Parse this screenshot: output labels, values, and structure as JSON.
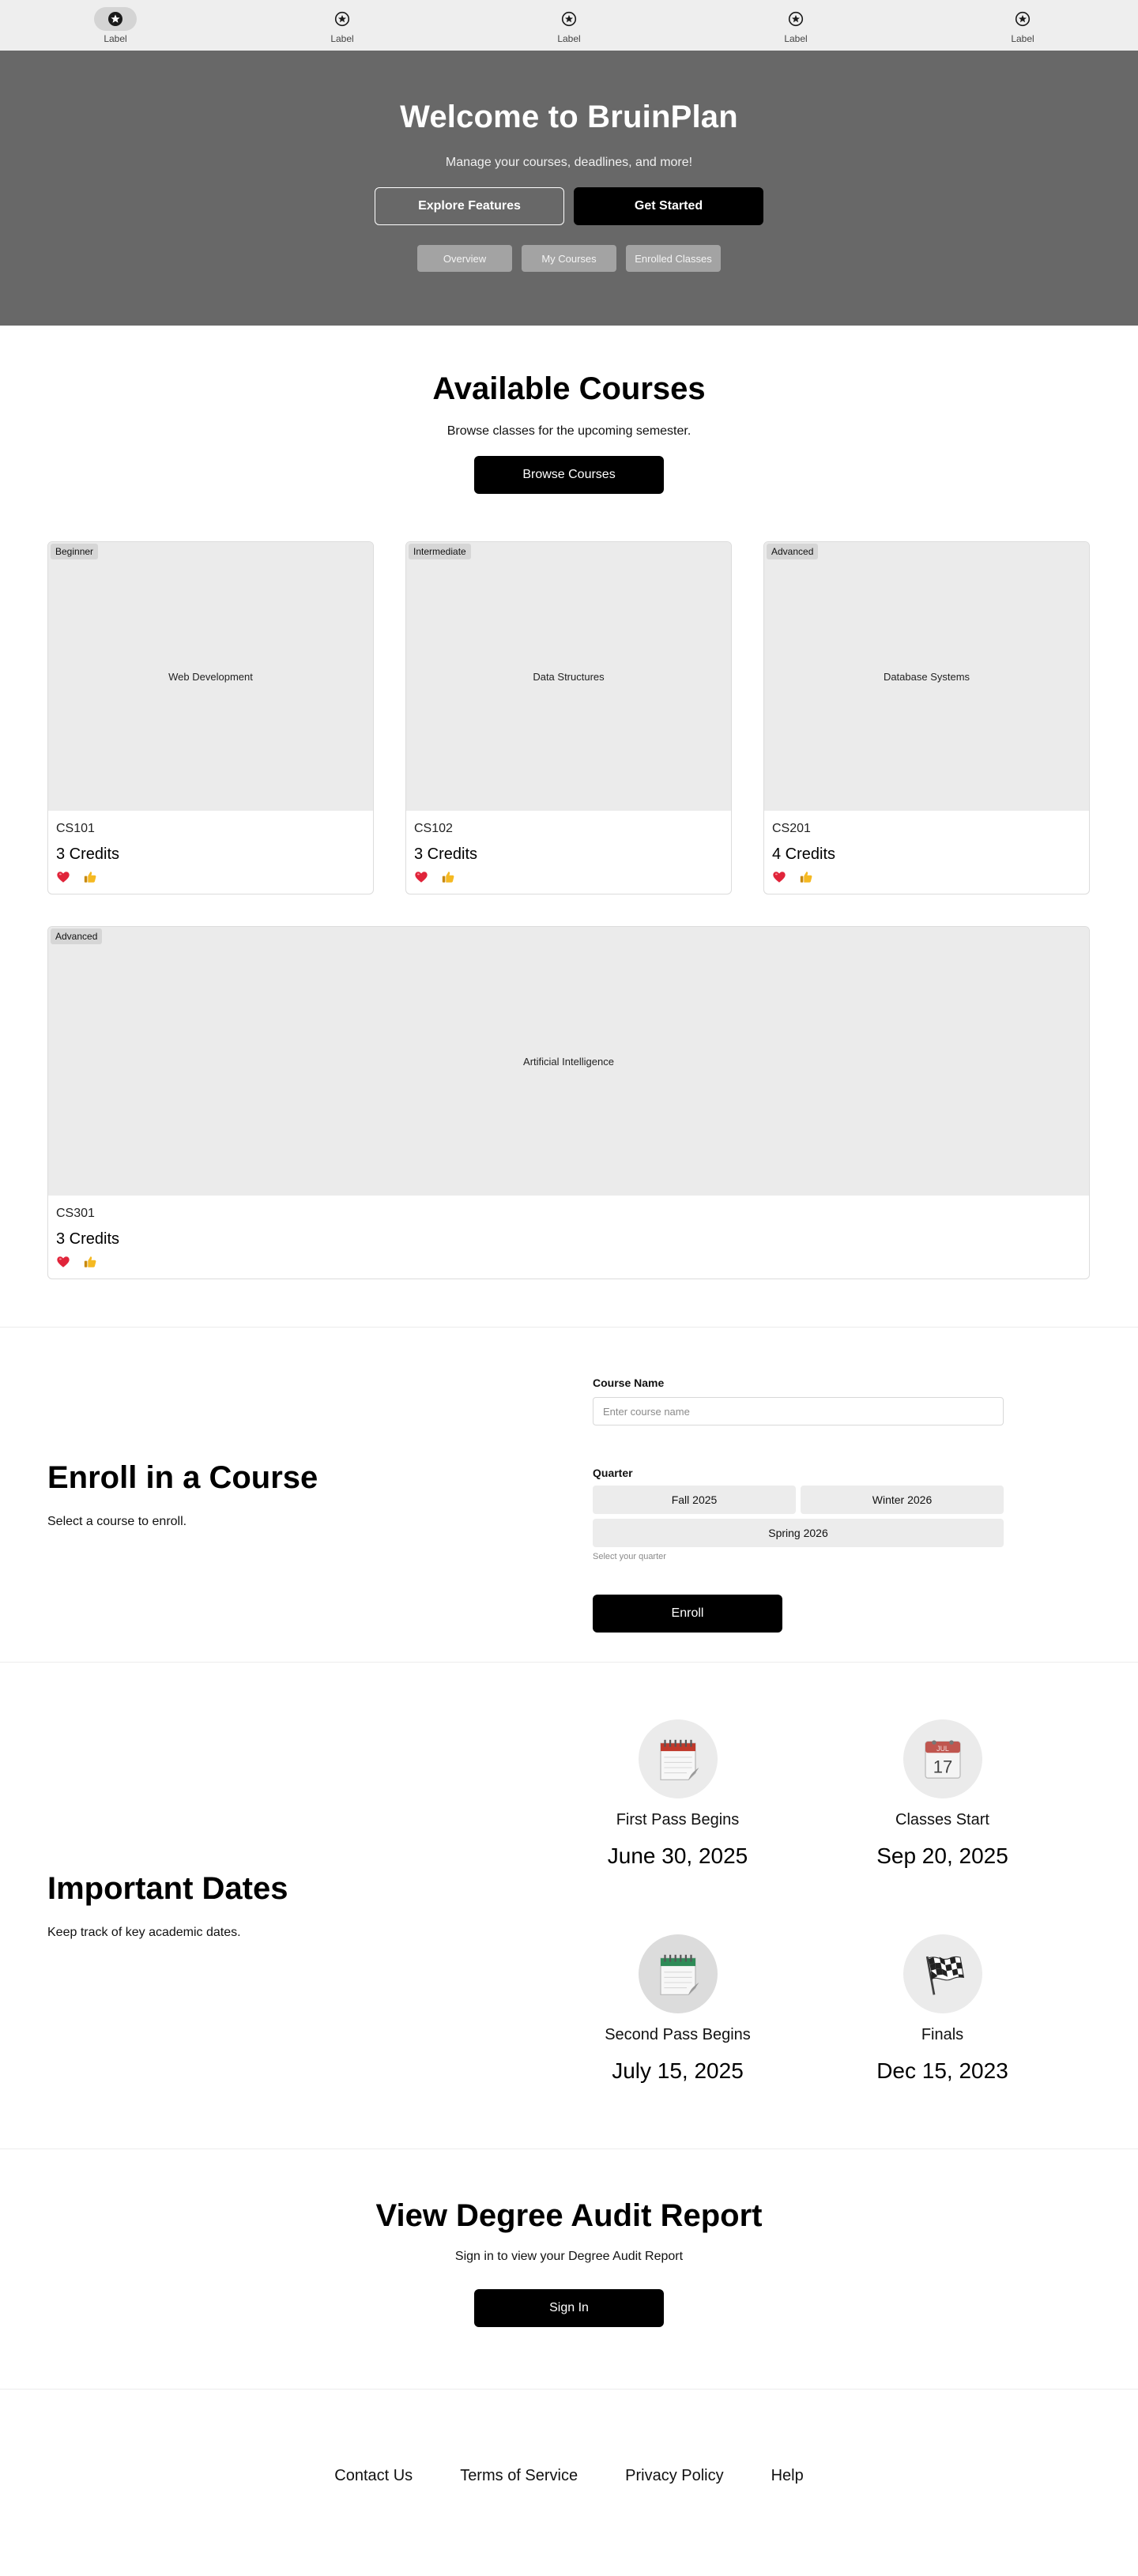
{
  "nav": {
    "items": [
      {
        "label": "Label",
        "icon": "star-circle-icon",
        "active": true
      },
      {
        "label": "Label",
        "icon": "star-circle-icon",
        "active": false
      },
      {
        "label": "Label",
        "icon": "star-circle-icon",
        "active": false
      },
      {
        "label": "Label",
        "icon": "star-circle-icon",
        "active": false
      },
      {
        "label": "Label",
        "icon": "star-circle-icon",
        "active": false
      }
    ]
  },
  "hero": {
    "title": "Welcome to BruinPlan",
    "subtitle": "Manage your courses, deadlines, and more!",
    "explore_label": "Explore Features",
    "started_label": "Get Started",
    "tabs": [
      "Overview",
      "My Courses",
      "Enrolled Classes"
    ]
  },
  "courses": {
    "title": "Available Courses",
    "subtitle": "Browse classes for the upcoming semester.",
    "button_label": "Browse Courses",
    "items": [
      {
        "badge": "Beginner",
        "image_label": "Web Development",
        "code": "CS101",
        "credits": "3 Credits"
      },
      {
        "badge": "Intermediate",
        "image_label": "Data Structures",
        "code": "CS102",
        "credits": "3 Credits"
      },
      {
        "badge": "Advanced",
        "image_label": "Database Systems",
        "code": "CS201",
        "credits": "4 Credits"
      },
      {
        "badge": "Advanced",
        "image_label": "Artificial Intelligence",
        "code": "CS301",
        "credits": "3 Credits"
      }
    ]
  },
  "enroll": {
    "title": "Enroll in a Course",
    "subtitle": "Select a course to enroll.",
    "course_label": "Course Name",
    "course_value": "",
    "course_placeholder": "Enter course name",
    "quarter_label": "Quarter",
    "quarters": [
      "Fall 2025",
      "Winter 2026",
      "Spring 2026"
    ],
    "helper": "Select your quarter",
    "button_label": "Enroll"
  },
  "dates": {
    "title": "Important Dates",
    "subtitle": "Keep track of key academic dates.",
    "items": [
      {
        "icon": "spiral-calendar-icon",
        "label": "First Pass Begins",
        "date": "June 30, 2025"
      },
      {
        "icon": "calendar-17-icon",
        "label": "Classes Start",
        "date": "Sep 20, 2025"
      },
      {
        "icon": "spiral-calendar-icon",
        "label": "Second Pass Begins",
        "date": "July 15, 2025"
      },
      {
        "icon": "checkered-flag-icon",
        "label": "Finals",
        "date": "Dec 15, 2023"
      }
    ],
    "calendar_month": "JUL",
    "calendar_day": "17"
  },
  "audit": {
    "title": "View Degree Audit Report",
    "subtitle": "Sign in to view your Degree Audit Report",
    "button_label": "Sign In"
  },
  "footer": {
    "links": [
      "Contact Us",
      "Terms of Service",
      "Privacy Policy",
      "Help"
    ]
  },
  "colors": {
    "hero_bg": "#686868",
    "nav_bg": "#eeeeee",
    "primary_button": "#000000",
    "heart": "#e0243a",
    "thumb": "#f5b922"
  }
}
